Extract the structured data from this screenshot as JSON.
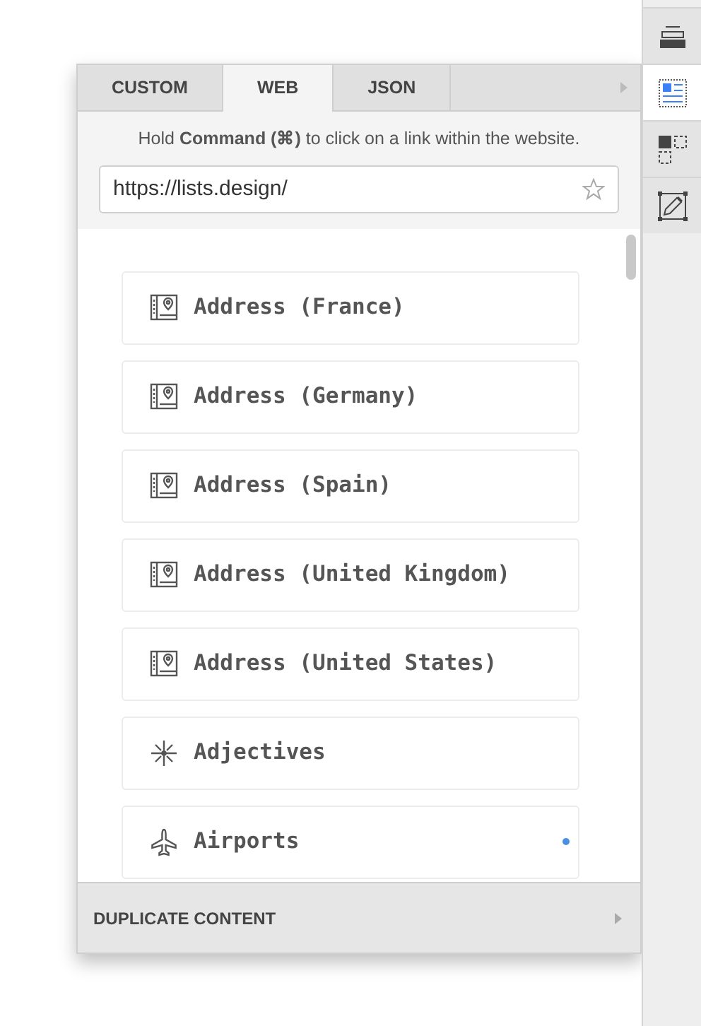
{
  "tabs": [
    {
      "label": "CUSTOM",
      "selected": false
    },
    {
      "label": "WEB",
      "selected": true
    },
    {
      "label": "JSON",
      "selected": false
    }
  ],
  "hint": "Hold **Command (⌘)** to click on a link within the website.",
  "url_field": {
    "value": "https://lists.design/"
  },
  "items": [
    {
      "kind": "address",
      "label": "Address (France)",
      "marked": false
    },
    {
      "kind": "address",
      "label": "Address (Germany)",
      "marked": false
    },
    {
      "kind": "address",
      "label": "Address (Spain)",
      "marked": false
    },
    {
      "kind": "address",
      "label": "Address (United Kingdom)",
      "marked": false
    },
    {
      "kind": "address",
      "label": "Address (United States)",
      "marked": false
    },
    {
      "kind": "sparkle",
      "label": "Adjectives",
      "marked": false
    },
    {
      "kind": "plane",
      "label": "Airports",
      "marked": true
    }
  ],
  "footer": {
    "label": "DUPLICATE CONTENT"
  },
  "toolbar": [
    {
      "kind": "layers",
      "selected": false
    },
    {
      "kind": "data",
      "selected": true
    },
    {
      "kind": "symbols",
      "selected": false
    },
    {
      "kind": "edit",
      "selected": false
    }
  ]
}
